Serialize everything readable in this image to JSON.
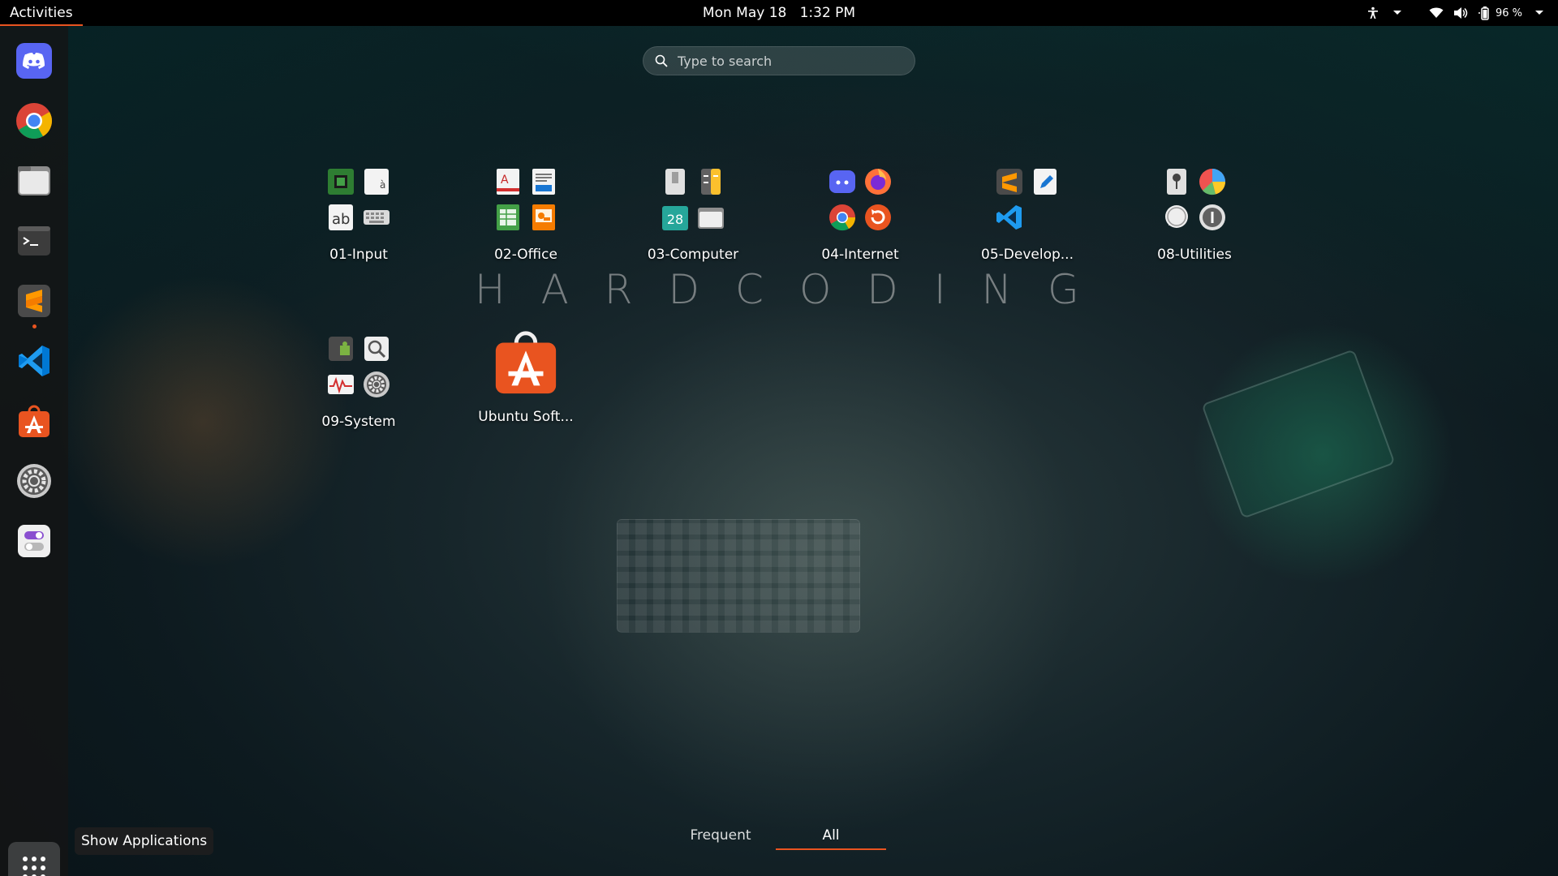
{
  "topbar": {
    "activities": "Activities",
    "date": "Mon May 18",
    "time": "1:32 PM",
    "battery": "96 %"
  },
  "search": {
    "placeholder": "Type to search"
  },
  "watermark": "HARDCODING",
  "dock": {
    "items": [
      {
        "name": "discord-icon"
      },
      {
        "name": "chrome-icon"
      },
      {
        "name": "files-icon"
      },
      {
        "name": "terminal-icon"
      },
      {
        "name": "sublime-text-icon",
        "running": true
      },
      {
        "name": "vscode-icon"
      },
      {
        "name": "ubuntu-software-icon"
      },
      {
        "name": "settings-icon"
      },
      {
        "name": "tweaks-icon"
      }
    ],
    "show_apps_tooltip": "Show Applications"
  },
  "folders": [
    {
      "label": "01-Input",
      "icons": [
        "chip-icon",
        "character-map-icon",
        "text-spell-icon",
        "keyboard-icon"
      ]
    },
    {
      "label": "02-Office",
      "icons": [
        "document-viewer-icon",
        "writer-icon",
        "calc-icon",
        "impress-icon"
      ]
    },
    {
      "label": "03-Computer",
      "icons": [
        "usb-icon",
        "calculator-icon",
        "calendar-icon",
        "folder-icon"
      ],
      "calendar_day": "28"
    },
    {
      "label": "04-Internet",
      "icons": [
        "discord-icon",
        "firefox-icon",
        "chrome-icon",
        "update-icon"
      ]
    },
    {
      "label": "05-Develop...",
      "icons": [
        "sublime-text-icon",
        "text-editor-icon",
        "vscode-icon",
        "blank-icon"
      ]
    },
    {
      "label": "08-Utilities",
      "icons": [
        "map-pin-icon",
        "pie-chart-icon",
        "chat-icon",
        "info-icon"
      ]
    },
    {
      "label": "09-System",
      "icons": [
        "extension-icon",
        "magnifier-icon",
        "system-monitor-icon",
        "settings-icon"
      ]
    }
  ],
  "apps": [
    {
      "label": "Ubuntu Soft..."
    }
  ],
  "tabs": {
    "frequent": "Frequent",
    "all": "All"
  },
  "colors": {
    "accent": "#e95420",
    "topbar": "#000000",
    "dock": "#141414"
  }
}
